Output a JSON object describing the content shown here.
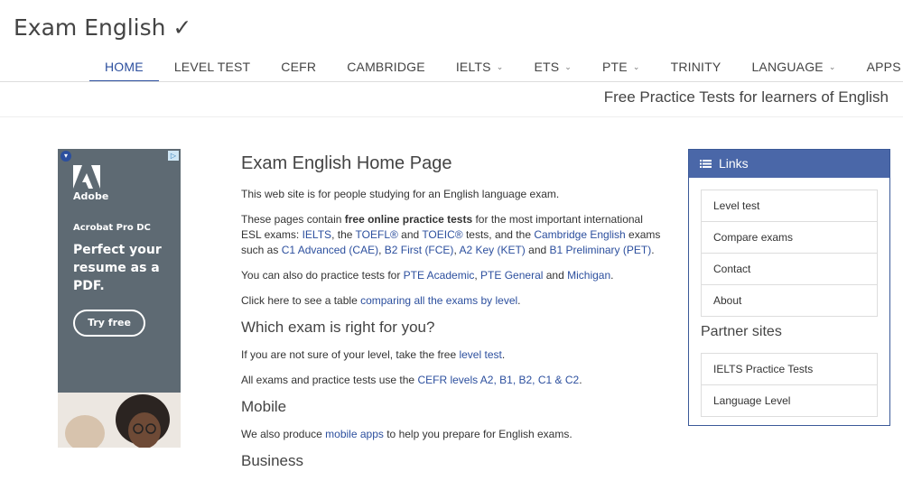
{
  "site": {
    "title": "Exam English ✓"
  },
  "nav": {
    "items": [
      {
        "label": "HOME"
      },
      {
        "label": "LEVEL TEST"
      },
      {
        "label": "CEFR"
      },
      {
        "label": "CAMBRIDGE"
      },
      {
        "label": "IELTS",
        "chevron": "⌄"
      },
      {
        "label": "ETS",
        "chevron": "⌄"
      },
      {
        "label": "PTE",
        "chevron": "⌄"
      },
      {
        "label": "TRINITY"
      },
      {
        "label": "LANGUAGE",
        "chevron": "⌄"
      },
      {
        "label": "APPS"
      }
    ]
  },
  "tagline": "Free Practice Tests for learners of English",
  "ad": {
    "brand": "Adobe",
    "product": "Acrobat Pro DC",
    "headline": "Perfect your resume as a PDF.",
    "cta": "Try free",
    "brand_color": "#5e6a73"
  },
  "main": {
    "title": "Exam English Home Page",
    "p1": "This web site is for people studying for an English language exam.",
    "p2": {
      "t1": "These pages contain ",
      "bold": "free online practice tests",
      "t2": " for the most important international ESL exams: ",
      "l_ielts": "IELTS",
      "t3": ", the ",
      "l_toefl": "TOEFL®",
      "t4": " and ",
      "l_toeic": "TOEIC®",
      "t5": " tests, and the ",
      "l_cam": "Cambridge English",
      "t6": " exams such as ",
      "l_c1": "C1 Advanced (CAE)",
      "t7": ", ",
      "l_b2": "B2 First (FCE)",
      "t8": ", ",
      "l_a2": "A2 Key (KET)",
      "t9": " and ",
      "l_b1": "B1 Preliminary (PET)",
      "t10": "."
    },
    "p3": {
      "t1": "You can also do practice tests for ",
      "l_pte_ac": "PTE Academic",
      "t2": ", ",
      "l_pte_gen": "PTE General",
      "t3": " and ",
      "l_mich": "Michigan",
      "t4": "."
    },
    "p4": {
      "t1": "Click here to see a table ",
      "link": "comparing all the exams by level",
      "t2": "."
    },
    "h_which": "Which exam is right for you?",
    "p5": {
      "t1": "If you are not sure of your level, take the free ",
      "link": "level test",
      "t2": "."
    },
    "p6": {
      "t1": "All exams and practice tests use the ",
      "link": "CEFR levels A2, B1, B2, C1 & C2",
      "t2": "."
    },
    "h_mobile": "Mobile",
    "p7": {
      "t1": "We also produce ",
      "link": "mobile apps",
      "t2": " to help you prepare for English exams."
    },
    "h_business": "Business"
  },
  "sidebar": {
    "header": "Links",
    "header_color": "#4a67a8",
    "links": [
      {
        "label": "Level test"
      },
      {
        "label": "Compare exams"
      },
      {
        "label": "Contact"
      },
      {
        "label": "About"
      }
    ],
    "partner_title": "Partner sites",
    "partners": [
      {
        "label": "IELTS Practice Tests"
      },
      {
        "label": "Language Level"
      }
    ]
  }
}
